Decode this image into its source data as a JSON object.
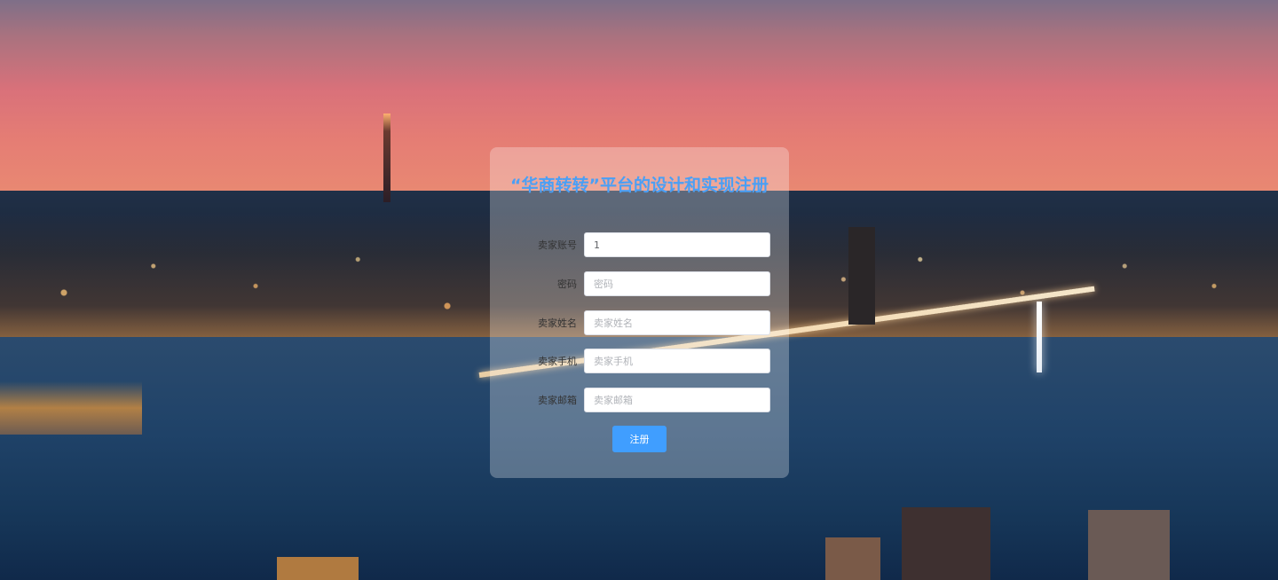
{
  "register": {
    "title": "“华商转转”平台的设计和实现注册",
    "fields": [
      {
        "label": "卖家账号",
        "value": "1",
        "placeholder": ""
      },
      {
        "label": "密码",
        "value": "",
        "placeholder": "密码"
      },
      {
        "label": "卖家姓名",
        "value": "",
        "placeholder": "卖家姓名"
      },
      {
        "label": "卖家手机",
        "value": "",
        "placeholder": "卖家手机"
      },
      {
        "label": "卖家邮箱",
        "value": "",
        "placeholder": "卖家邮箱"
      }
    ],
    "submit_label": "注册"
  },
  "colors": {
    "title": "#4a9ff5",
    "button": "#409eff",
    "card_background": "rgba(255,255,255,0.28)"
  }
}
